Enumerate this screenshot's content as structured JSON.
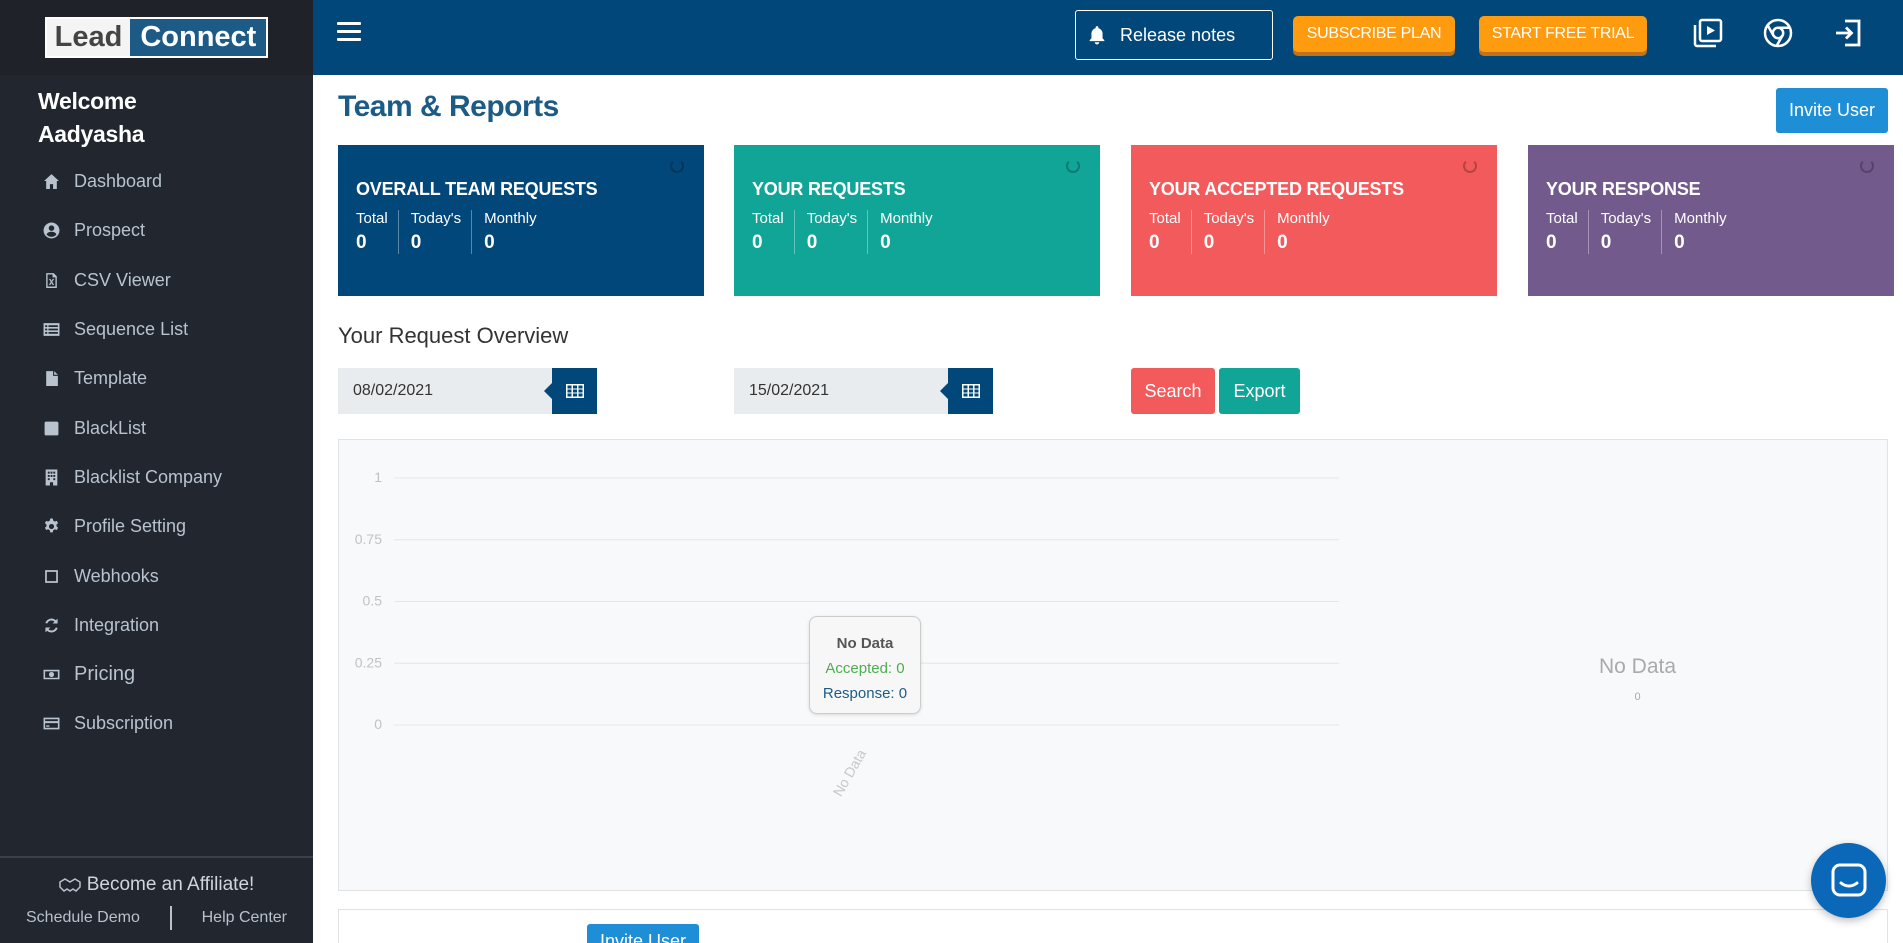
{
  "sidebar": {
    "logo": {
      "lead": "Lead",
      "connect": "Connect"
    },
    "welcome_line1": "Welcome",
    "welcome_line2": "Aadyasha",
    "items": [
      {
        "label": "Dashboard",
        "icon": "home-icon"
      },
      {
        "label": "Prospect",
        "icon": "user-circle-icon"
      },
      {
        "label": "CSV Viewer",
        "icon": "csv-file-icon"
      },
      {
        "label": "Sequence List",
        "icon": "list-icon"
      },
      {
        "label": "Template",
        "icon": "file-icon"
      },
      {
        "label": "BlackList",
        "icon": "square-icon"
      },
      {
        "label": "Blacklist Company",
        "icon": "building-icon"
      },
      {
        "label": "Profile Setting",
        "icon": "gear-icon"
      },
      {
        "label": "Webhooks",
        "icon": "square-outline-icon"
      },
      {
        "label": "Integration",
        "icon": "refresh-icon"
      },
      {
        "label": "Pricing",
        "icon": "money-icon"
      },
      {
        "label": "Subscription",
        "icon": "credit-card-icon"
      }
    ],
    "affiliate": "Become an Affiliate!",
    "schedule_demo": "Schedule Demo",
    "help_center": "Help Center"
  },
  "topbar": {
    "release_notes": "Release notes",
    "subscribe": "SUBSCRIBE PLAN",
    "free_trial": "START FREE TRIAL"
  },
  "main": {
    "title": "Team & Reports",
    "invite_user": "Invite User",
    "cards": [
      {
        "title": "OVERALL TEAM REQUESTS",
        "color": "#02477a",
        "total_label": "Total",
        "today_label": "Today's",
        "monthly_label": "Monthly",
        "total": "0",
        "today": "0",
        "monthly": "0"
      },
      {
        "title": "YOUR REQUESTS",
        "color": "#11a597",
        "total_label": "Total",
        "today_label": "Today's",
        "monthly_label": "Monthly",
        "total": "0",
        "today": "0",
        "monthly": "0"
      },
      {
        "title": "YOUR ACCEPTED REQUESTS",
        "color": "#f35a5b",
        "total_label": "Total",
        "today_label": "Today's",
        "monthly_label": "Monthly",
        "total": "0",
        "today": "0",
        "monthly": "0"
      },
      {
        "title": "YOUR RESPONSE",
        "color": "#725a8c",
        "total_label": "Total",
        "today_label": "Today's",
        "monthly_label": "Monthly",
        "total": "0",
        "today": "0",
        "monthly": "0"
      }
    ],
    "overview_title": "Your Request Overview",
    "date_from": "08/02/2021",
    "date_to": "15/02/2021",
    "search": "Search",
    "export": "Export",
    "invite_user_bottom": "Invite User"
  },
  "chart_data": [
    {
      "type": "bar",
      "categories": [
        "No Data"
      ],
      "series": [
        {
          "name": "Accepted",
          "values": [
            0
          ],
          "color": "#4caf50"
        },
        {
          "name": "Response",
          "values": [
            0
          ],
          "color": "#1d5b87"
        }
      ],
      "yticks": [
        "1",
        "0.75",
        "0.5",
        "0.25",
        "0"
      ],
      "ylim": [
        0,
        1
      ],
      "grid": true,
      "tooltip": {
        "title": "No Data",
        "accepted": "Accepted: 0",
        "response": "Response: 0"
      }
    },
    {
      "type": "pie",
      "labels": [
        "No Data"
      ],
      "values": [
        0
      ],
      "center_text": "No Data",
      "center_value": "0"
    }
  ]
}
